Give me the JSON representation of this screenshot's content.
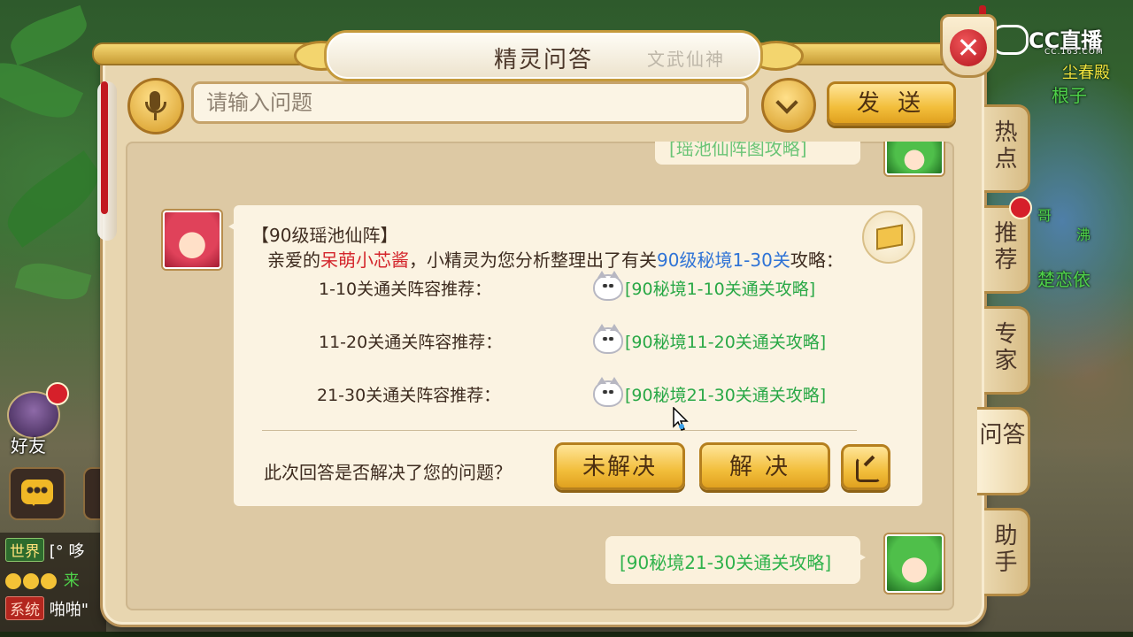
{
  "dialog": {
    "title": "精灵问答",
    "title_ink": "文武仙神",
    "close_symbol": "✕"
  },
  "input": {
    "placeholder": "请输入问题",
    "value": "",
    "send_label": "发 送"
  },
  "chat": {
    "prev_link_partial": "[瑶池仙阵图攻略]",
    "answer": {
      "heading": "【90级瑶池仙阵】",
      "greeting_prefix": "亲爱的",
      "user_name": "呆萌小芯酱",
      "greeting_middle": "，小精灵为您分析整理出了有关",
      "topic": "90级秘境1-30关",
      "greeting_suffix": "攻略：",
      "rows": [
        {
          "label": "1-10关通关阵容推荐：",
          "link": "[90秘境1-10关通关攻略]"
        },
        {
          "label": "11-20关通关阵容推荐：",
          "link": "[90秘境11-20关通关攻略]"
        },
        {
          "label": "21-30关通关阵容推荐：",
          "link": "[90秘境21-30关通关攻略]"
        }
      ],
      "feedback_question": "此次回答是否解决了您的问题？",
      "unsolved_label": "未解决",
      "solved_label": "解决"
    },
    "user_message": "[90秘境21-30关通关攻略]"
  },
  "side_tabs": [
    {
      "label": "热点",
      "active": false,
      "badge": false
    },
    {
      "label": "推荐",
      "active": false,
      "badge": true
    },
    {
      "label": "专家",
      "active": false,
      "badge": false
    },
    {
      "label": "问答",
      "active": true,
      "badge": false
    },
    {
      "label": "助手",
      "active": false,
      "badge": false
    }
  ],
  "hud": {
    "friend_label": "好友",
    "chat_lines": [
      {
        "tag": "世界",
        "text": "[° 哆"
      },
      {
        "tag": "",
        "text": "来"
      },
      {
        "tag": "系统",
        "text": "啪啪\""
      }
    ],
    "npc_names": [
      "尘春殿",
      "根子",
      "楚恋依",
      "哥",
      "沸"
    ]
  },
  "overlay": {
    "logo_text": "CC直播",
    "logo_sub": "CC.163.COM"
  },
  "colors": {
    "link_green": "#29a846",
    "topic_blue": "#2f73d6",
    "name_red": "#d4262c",
    "button_gold": "#f2be3b"
  }
}
